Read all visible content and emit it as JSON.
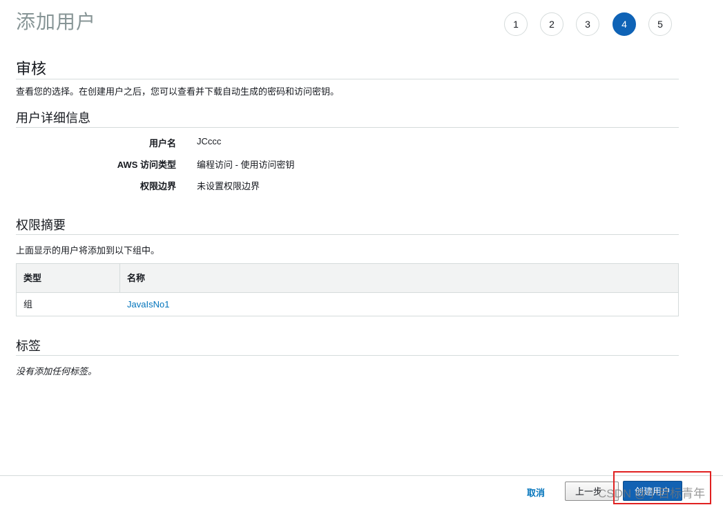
{
  "page": {
    "title": "添加用户"
  },
  "wizard": {
    "steps": [
      "1",
      "2",
      "3",
      "4",
      "5"
    ],
    "current_step": "4",
    "active_color": "#0f63b6"
  },
  "review": {
    "title": "审核",
    "description": "查看您的选择。在创建用户之后，您可以查看并下载自动生成的密码和访问密钥。"
  },
  "user_details": {
    "title": "用户详细信息",
    "rows": [
      {
        "label": "用户名",
        "value": "JCccc"
      },
      {
        "label": "AWS 访问类型",
        "value": "编程访问 - 使用访问密钥"
      },
      {
        "label": "权限边界",
        "value": "未设置权限边界"
      }
    ]
  },
  "permissions": {
    "title": "权限摘要",
    "description": "上面显示的用户将添加到以下组中。",
    "columns": [
      "类型",
      "名称"
    ],
    "rows": [
      {
        "type": "组",
        "name": "JavaIsNo1"
      }
    ]
  },
  "tags": {
    "title": "标签",
    "empty_text": "没有添加任何标签。"
  },
  "footer": {
    "cancel_label": "取消",
    "previous_label": "上一步",
    "create_label": "创建用户",
    "watermark": "CSDN @小目标青年"
  },
  "colors": {
    "link": "#0073bb",
    "primary": "#1262b3",
    "highlight_box": "#e02020"
  }
}
